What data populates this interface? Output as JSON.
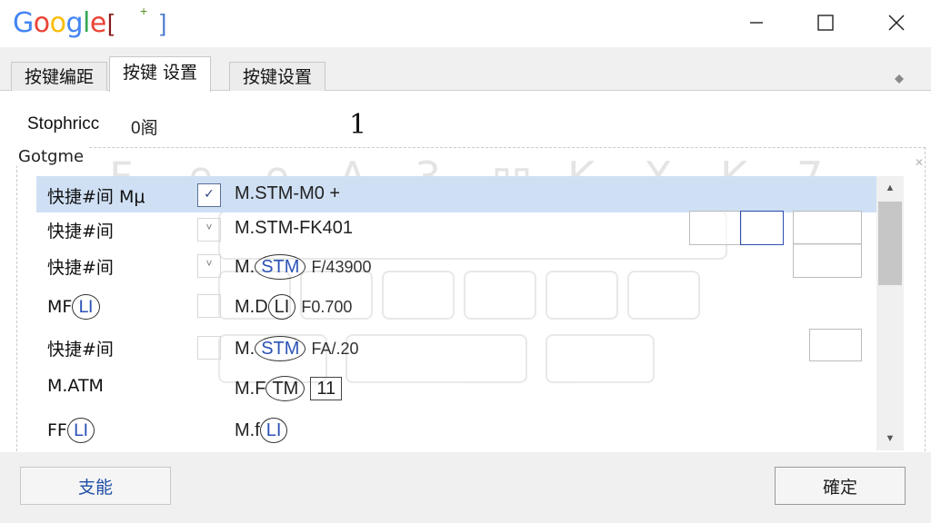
{
  "titlebar": {
    "logo_letters": [
      {
        "ch": "G",
        "color": "#4285F4"
      },
      {
        "ch": "o",
        "color": "#EA4335"
      },
      {
        "ch": "o",
        "color": "#FBBC05"
      },
      {
        "ch": "g",
        "color": "#4285F4"
      },
      {
        "ch": "l",
        "color": "#34A853"
      },
      {
        "ch": "e",
        "color": "#EA4335"
      }
    ],
    "marks": [
      "[",
      "+",
      "]"
    ],
    "minimize_icon": "minimize-icon",
    "maximize_icon": "maximize-icon",
    "close_icon": "close-icon"
  },
  "tabs": [
    {
      "label": "按键编距"
    },
    {
      "label": "按键 设置",
      "active": true
    },
    {
      "label": "按键设置"
    }
  ],
  "header": {
    "stop_label": "Stophric",
    "stop_suffix": "c",
    "stop_value": "0阁",
    "big_number": "1",
    "group_label": "Gotgme"
  },
  "rows": [
    {
      "c1": "快捷#间 Mμ",
      "check": "✓",
      "c3": "M.STM-M0 +",
      "selected": true
    },
    {
      "c1": "快捷#间",
      "check": "˅",
      "c3": "M.STM-FK401"
    },
    {
      "c1": "快捷#间",
      "check": "˅",
      "c3_pre": "M.",
      "c3_oval": "STM",
      "c3_post": "F/43900"
    },
    {
      "c1_pre": "MF",
      "c1_oval": "LI",
      "c3_pre": "M.D",
      "c3_oval": "LI",
      "c3_post": "F0.700"
    },
    {
      "c1": "快捷#间",
      "c3_pre": "M.",
      "c3_oval": "STM",
      "c3_post": "FA/.20"
    },
    {
      "c1": "M.ATM",
      "c3_pre": "M.F",
      "c3_oval": "TM",
      "c3_box": "11"
    },
    {
      "c1_pre": "FF",
      "c1_oval": "LI",
      "c3_pre": "M.f",
      "c3_oval": "LI"
    }
  ],
  "keyboard_glyphs": [
    "F",
    "∩",
    "∩",
    "A",
    "3",
    "凹",
    "K",
    "X",
    "K",
    "7"
  ],
  "bottom": {
    "left_button": "支能",
    "right_button": "確定"
  },
  "colors": {
    "selection": "#cfe0f4",
    "accent_blue": "#2f4fb0"
  }
}
